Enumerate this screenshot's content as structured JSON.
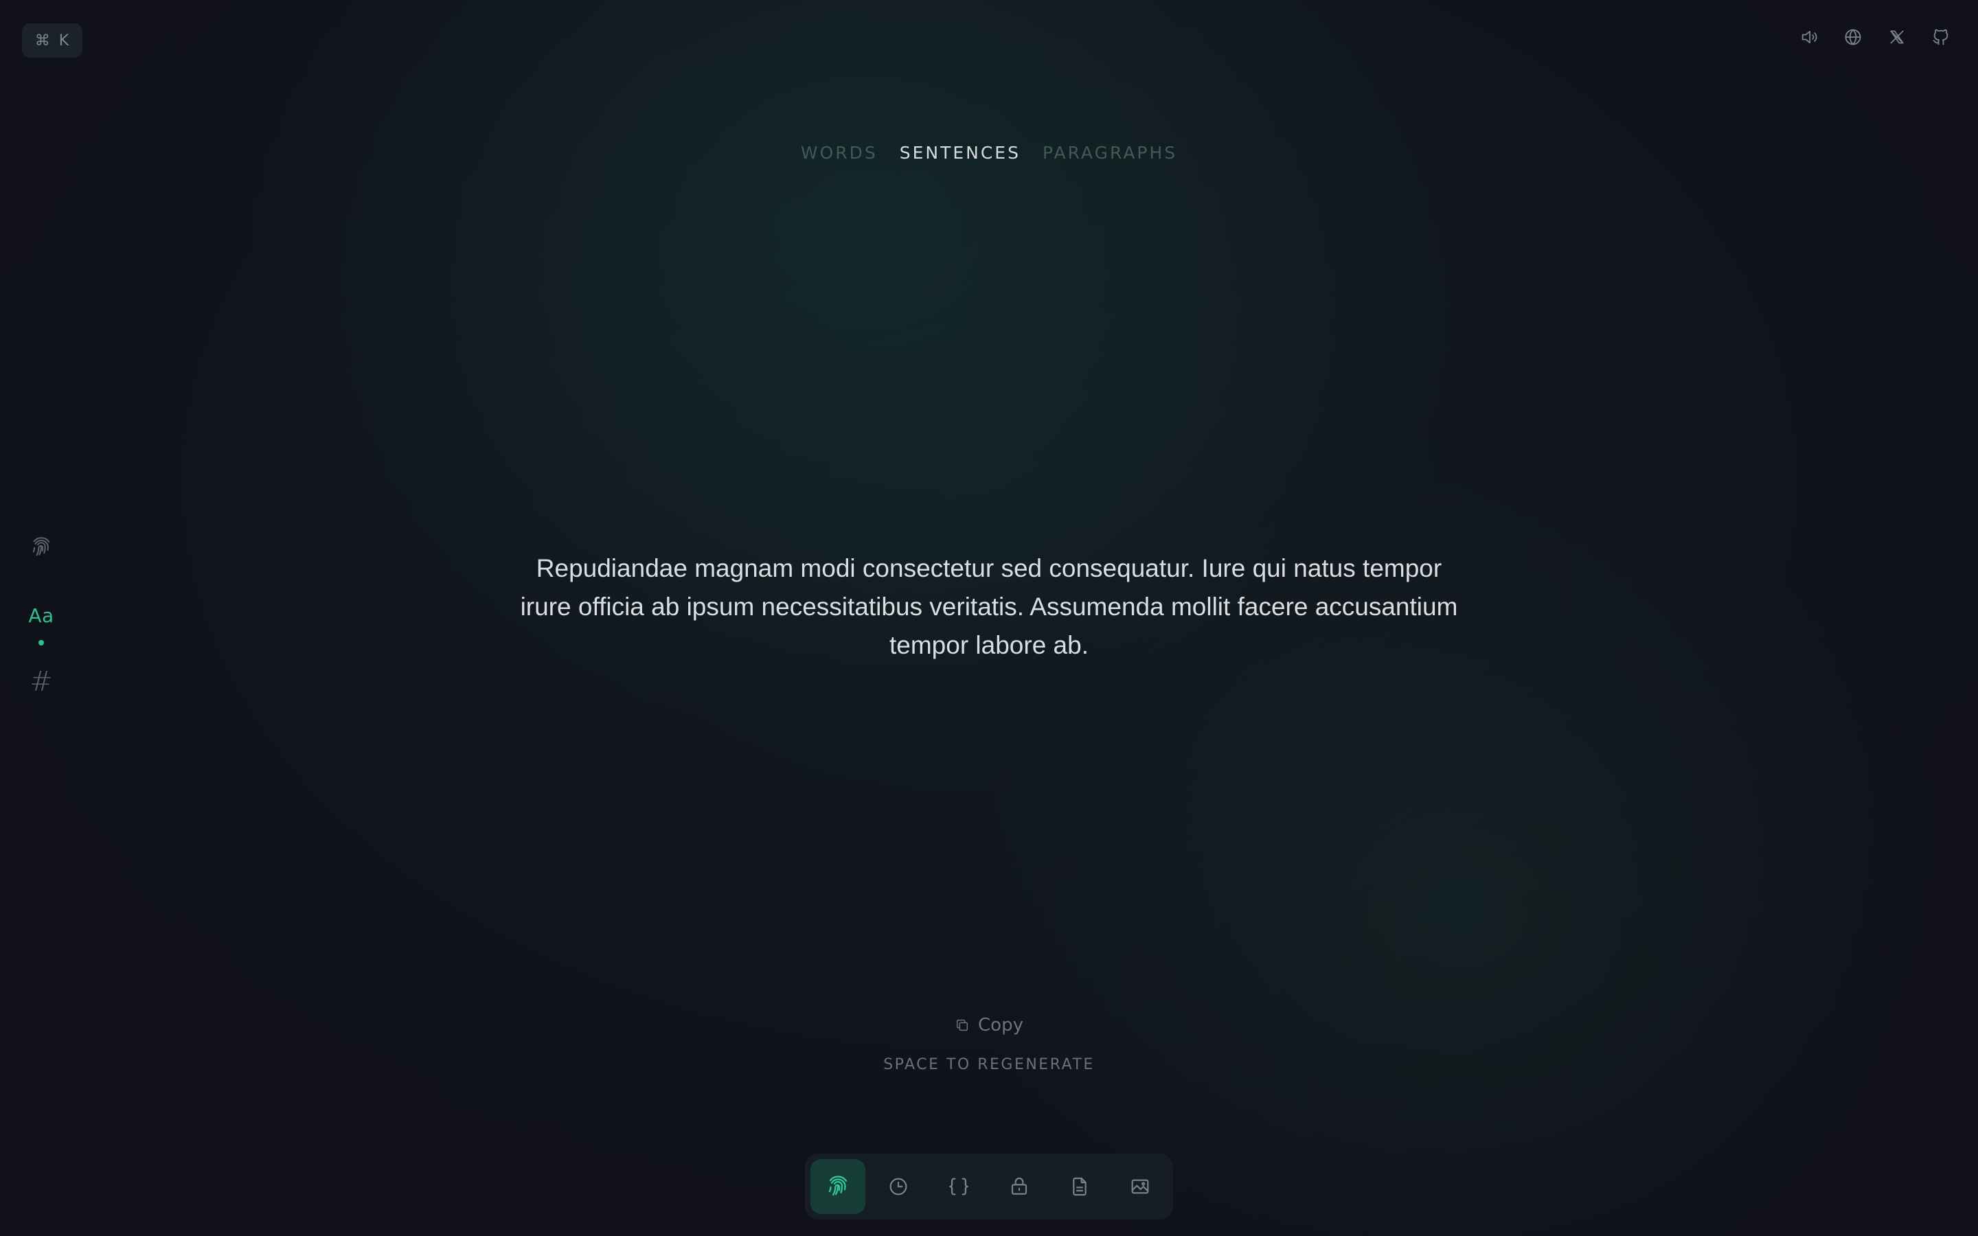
{
  "shortcut": {
    "symbol": "⌘",
    "key": "K"
  },
  "top_icons": [
    "speaker-icon",
    "globe-icon",
    "x-logo-icon",
    "github-icon"
  ],
  "tabs": [
    {
      "label": "WORDS",
      "active": false
    },
    {
      "label": "SENTENCES",
      "active": true
    },
    {
      "label": "PARAGRAPHS",
      "active": false
    }
  ],
  "rail": {
    "items": [
      "fingerprint-icon",
      "text-mode",
      "number-mode"
    ],
    "text_label": "Aa",
    "number_label": "#"
  },
  "content": {
    "text": "Repudiandae magnam modi consectetur sed consequatur. Iure qui natus tempor irure officia ab ipsum necessitatibus veritatis. Assumenda mollit facere accusantium tempor labore ab."
  },
  "actions": {
    "copy_label": "Copy",
    "hint": "SPACE TO REGENERATE"
  },
  "dock": {
    "items": [
      "fingerprint-icon",
      "clock-icon",
      "braces-icon",
      "lock-icon",
      "document-icon",
      "image-icon"
    ],
    "active_index": 0
  },
  "colors": {
    "accent": "#2fbf95",
    "background": "#101019",
    "text": "#d9dee3",
    "muted": "#7b828a",
    "inactive_tab": "#3f5b54"
  }
}
